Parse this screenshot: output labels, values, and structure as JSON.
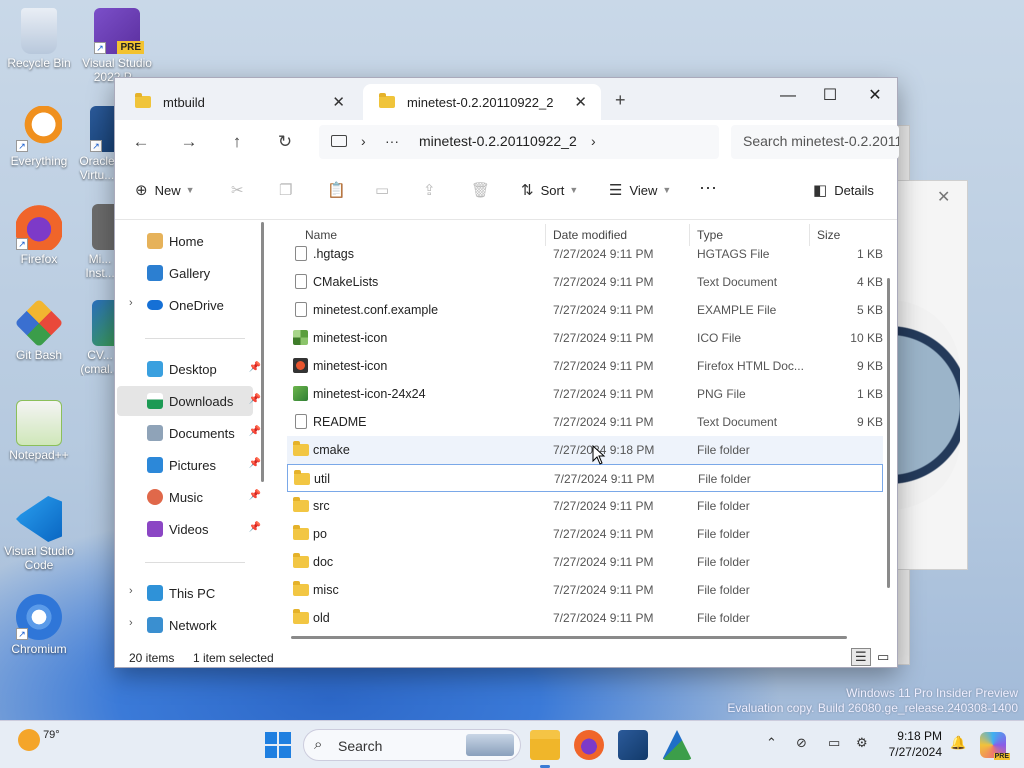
{
  "desktop": {
    "icons": [
      {
        "label": "Recycle Bin"
      },
      {
        "label": "Visual Studio 2022 P..."
      },
      {
        "label": "Everything"
      },
      {
        "label": "Oracle Virtu..."
      },
      {
        "label": "Firefox"
      },
      {
        "label": "Mi... Inst..."
      },
      {
        "label": "Git Bash"
      },
      {
        "label": "CV... (cmal..."
      },
      {
        "label": "Notepad++"
      },
      {
        "label": "Visual Studio Code"
      },
      {
        "label": "Chromium"
      }
    ],
    "vs_badge": "PRE"
  },
  "explorer": {
    "tabs": [
      {
        "label": "mtbuild"
      },
      {
        "label": "minetest-0.2.20110922_2"
      }
    ],
    "new_tab": "+",
    "controls": {
      "minimize": "—",
      "maximize": "☐",
      "close": "✕"
    },
    "address": {
      "ellipsis": "···",
      "crumb": "minetest-0.2.20110922_2",
      "search_placeholder": "Search minetest-0.2.2011"
    },
    "commands": {
      "new": "New",
      "sort": "Sort",
      "view": "View",
      "more": "···",
      "details": "Details"
    },
    "nav": {
      "quick": [
        {
          "label": "Home"
        },
        {
          "label": "Gallery"
        },
        {
          "label": "OneDrive"
        }
      ],
      "pinned": [
        {
          "label": "Desktop"
        },
        {
          "label": "Downloads"
        },
        {
          "label": "Documents"
        },
        {
          "label": "Pictures"
        },
        {
          "label": "Music"
        },
        {
          "label": "Videos"
        }
      ],
      "devices": [
        {
          "label": "This PC"
        },
        {
          "label": "Network"
        }
      ]
    },
    "columns": {
      "name": "Name",
      "date": "Date modified",
      "type": "Type",
      "size": "Size"
    },
    "files": [
      {
        "name": ".hgtags",
        "date": "7/27/2024 9:11 PM",
        "type": "HGTAGS File",
        "size": "1 KB",
        "icon": "doc"
      },
      {
        "name": "CMakeLists",
        "date": "7/27/2024 9:11 PM",
        "type": "Text Document",
        "size": "4 KB",
        "icon": "doc"
      },
      {
        "name": "minetest.conf.example",
        "date": "7/27/2024 9:11 PM",
        "type": "EXAMPLE File",
        "size": "5 KB",
        "icon": "doc"
      },
      {
        "name": "minetest-icon",
        "date": "7/27/2024 9:11 PM",
        "type": "ICO File",
        "size": "10 KB",
        "icon": "ico"
      },
      {
        "name": "minetest-icon",
        "date": "7/27/2024 9:11 PM",
        "type": "Firefox HTML Doc...",
        "size": "9 KB",
        "icon": "html"
      },
      {
        "name": "minetest-icon-24x24",
        "date": "7/27/2024 9:11 PM",
        "type": "PNG File",
        "size": "1 KB",
        "icon": "png"
      },
      {
        "name": "README",
        "date": "7/27/2024 9:11 PM",
        "type": "Text Document",
        "size": "9 KB",
        "icon": "doc"
      },
      {
        "name": "cmake",
        "date": "7/27/2024 9:18 PM",
        "type": "File folder",
        "size": "",
        "icon": "folder"
      },
      {
        "name": "util",
        "date": "7/27/2024 9:11 PM",
        "type": "File folder",
        "size": "",
        "icon": "folder"
      },
      {
        "name": "src",
        "date": "7/27/2024 9:11 PM",
        "type": "File folder",
        "size": "",
        "icon": "folder"
      },
      {
        "name": "po",
        "date": "7/27/2024 9:11 PM",
        "type": "File folder",
        "size": "",
        "icon": "folder"
      },
      {
        "name": "doc",
        "date": "7/27/2024 9:11 PM",
        "type": "File folder",
        "size": "",
        "icon": "folder"
      },
      {
        "name": "misc",
        "date": "7/27/2024 9:11 PM",
        "type": "File folder",
        "size": "",
        "icon": "folder"
      },
      {
        "name": "old",
        "date": "7/27/2024 9:11 PM",
        "type": "File folder",
        "size": "",
        "icon": "folder"
      }
    ],
    "status": {
      "count": "20 items",
      "selection": "1 item selected"
    }
  },
  "watermark": {
    "line1": "Windows 11 Pro Insider Preview",
    "line2": "Evaluation copy. Build 26080.ge_release.240308-1400"
  },
  "taskbar": {
    "temperature": "79°",
    "search_label": "Search",
    "time": "9:18 PM",
    "date": "7/27/2024",
    "copilot_badge": "PRE"
  },
  "colors": {
    "accent": "#3a7bd5",
    "folder": "#f2c643"
  }
}
